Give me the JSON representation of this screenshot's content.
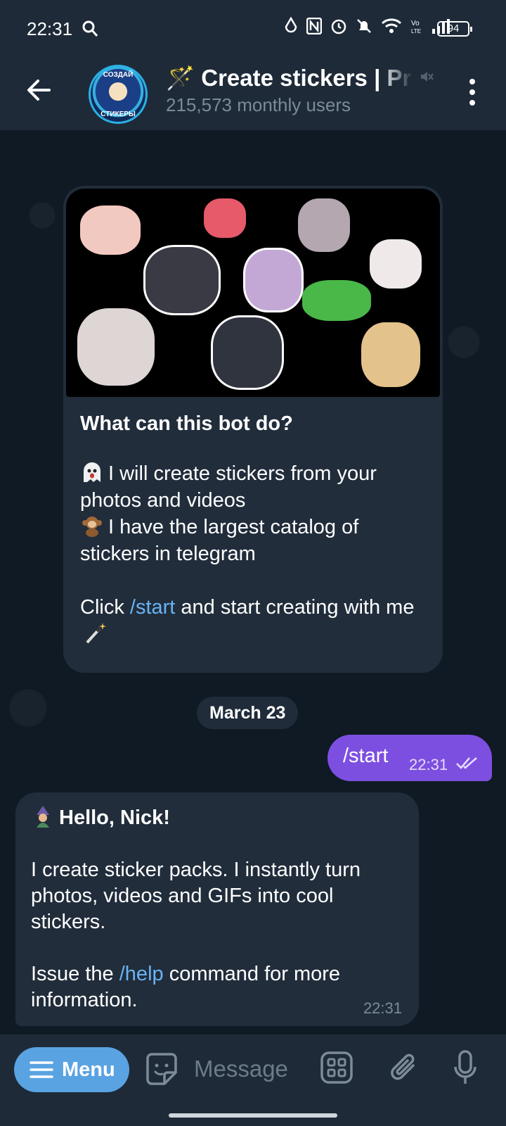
{
  "status_bar": {
    "time": "22:31",
    "battery": "94"
  },
  "header": {
    "title": "🪄 Create stickers | Pr",
    "subtitle": "215,573 monthly users",
    "avatar_text_top": "СОЗДАЙ",
    "avatar_text_bottom": "СТИКЕРЫ"
  },
  "bot_info": {
    "title": "What can this bot do?",
    "line1": "I will create stickers from your photos and videos",
    "line2": "I have the largest catalog of stickers in telegram",
    "line3_pre": "Click ",
    "line3_link": "/start",
    "line3_post": " and start creating with me",
    "emoji1": "ghost-emoji",
    "emoji2": "monkey-emoji",
    "emoji3": "magic-wand-emoji"
  },
  "date_separator": "March 23",
  "outgoing": {
    "text": "/start",
    "time": "22:31",
    "status": "read"
  },
  "incoming": {
    "greeting": "Hello, Nick!",
    "para1": "I create sticker packs. I instantly turn photos, videos and GIFs into cool stickers.",
    "para2_pre": "Issue the ",
    "para2_link": "/help",
    "para2_post": " command for more information.",
    "time": "22:31"
  },
  "input_bar": {
    "menu_label": "Menu",
    "placeholder": "Message"
  },
  "colors": {
    "accent": "#6ab3f3",
    "outgoing_bubble": "#7d4fe0",
    "menu_button": "#5aa3e2",
    "bubble": "#212d3b"
  }
}
